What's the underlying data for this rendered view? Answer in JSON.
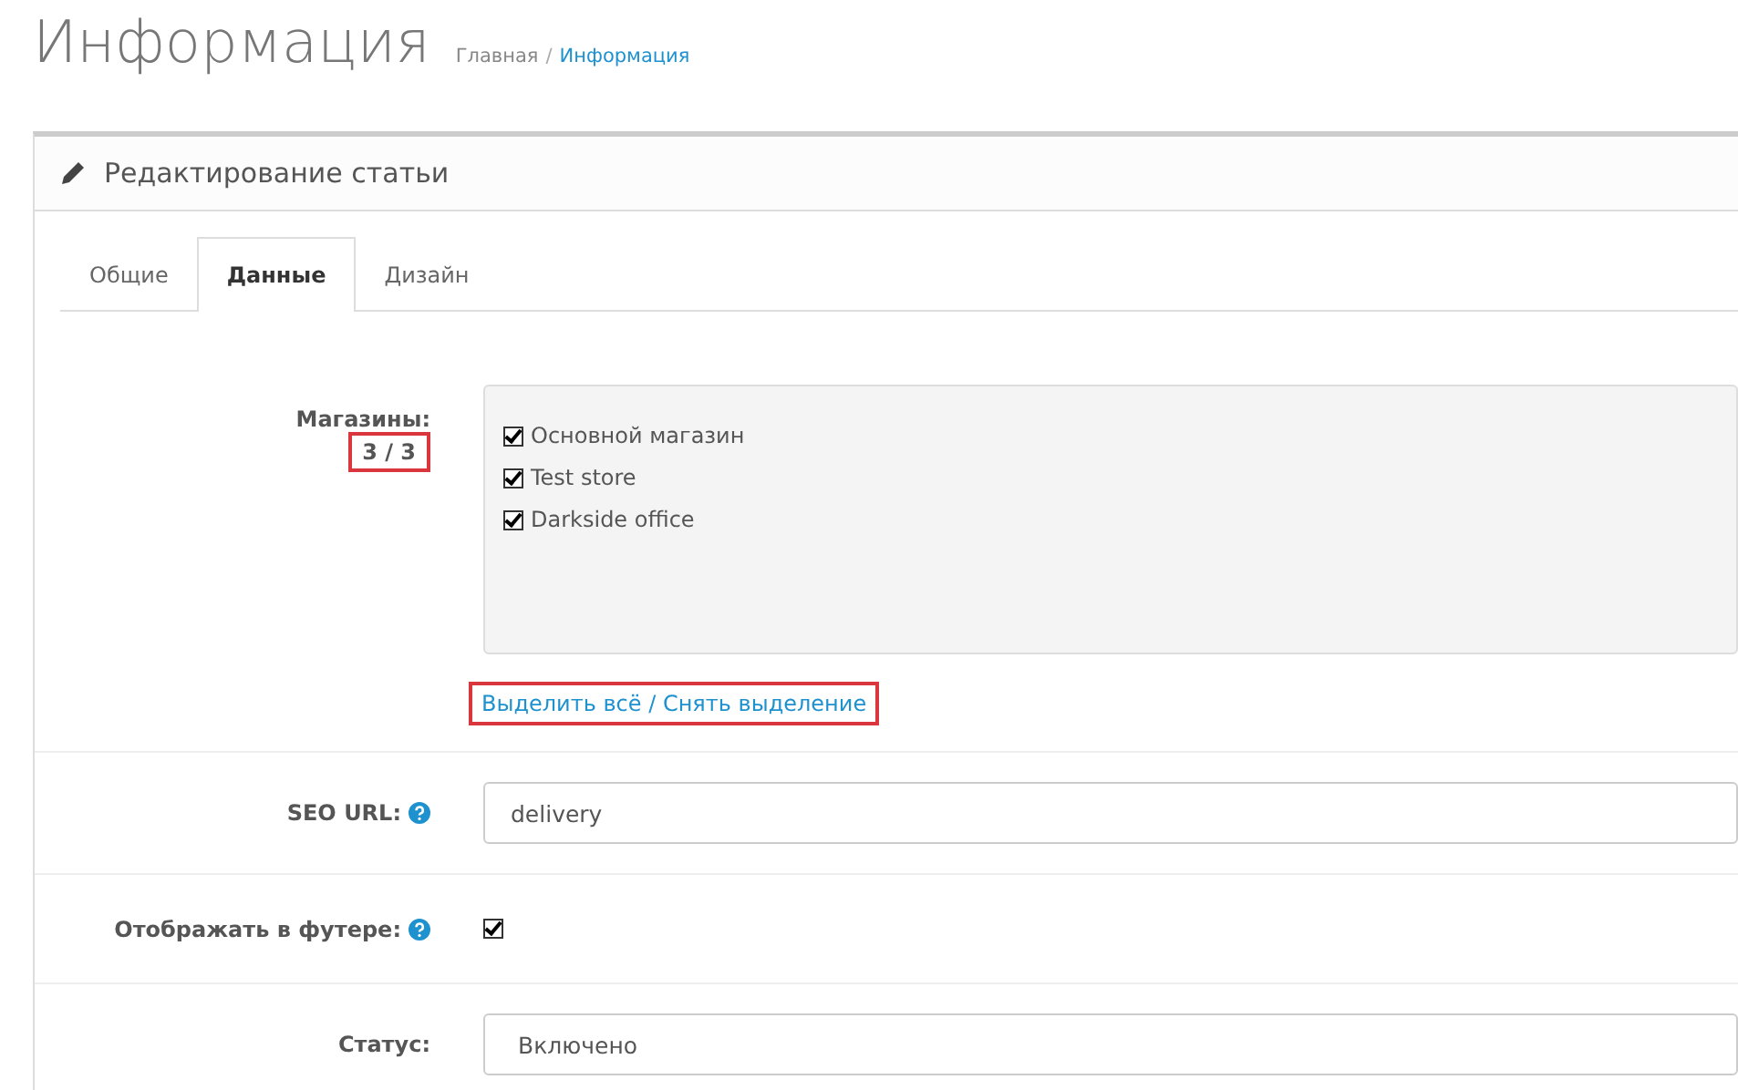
{
  "page_title": "Информация",
  "breadcrumbs": [
    {
      "label": "Главная",
      "current": false
    },
    {
      "label": "Информация",
      "current": true,
      "separator": "/"
    }
  ],
  "panel": {
    "title": "Редактирование статьи"
  },
  "tabs": [
    {
      "label": "Общие",
      "selected": false
    },
    {
      "label": "Данные",
      "selected": true
    },
    {
      "label": "Дизайн",
      "selected": false
    }
  ],
  "fields": [
    {
      "kind": "stores",
      "label": "Магазины:",
      "count": "3 / 3",
      "count_highlighted": true,
      "help": false,
      "options": [
        {
          "label": "Основной магазин",
          "checked": true
        },
        {
          "label": "Test store",
          "checked": true
        },
        {
          "label": "Darkside office",
          "checked": true
        }
      ],
      "select_links": "Выделить всё / Снять выделение",
      "links_highlighted": true
    },
    {
      "kind": "text",
      "label": "SEO URL:",
      "help": true,
      "value": "delivery"
    },
    {
      "kind": "checkbox",
      "label": "Отображать в футере:",
      "help": true,
      "checked": true
    },
    {
      "kind": "select",
      "label": "Статус:",
      "help": false,
      "value": "Включено"
    }
  ]
}
